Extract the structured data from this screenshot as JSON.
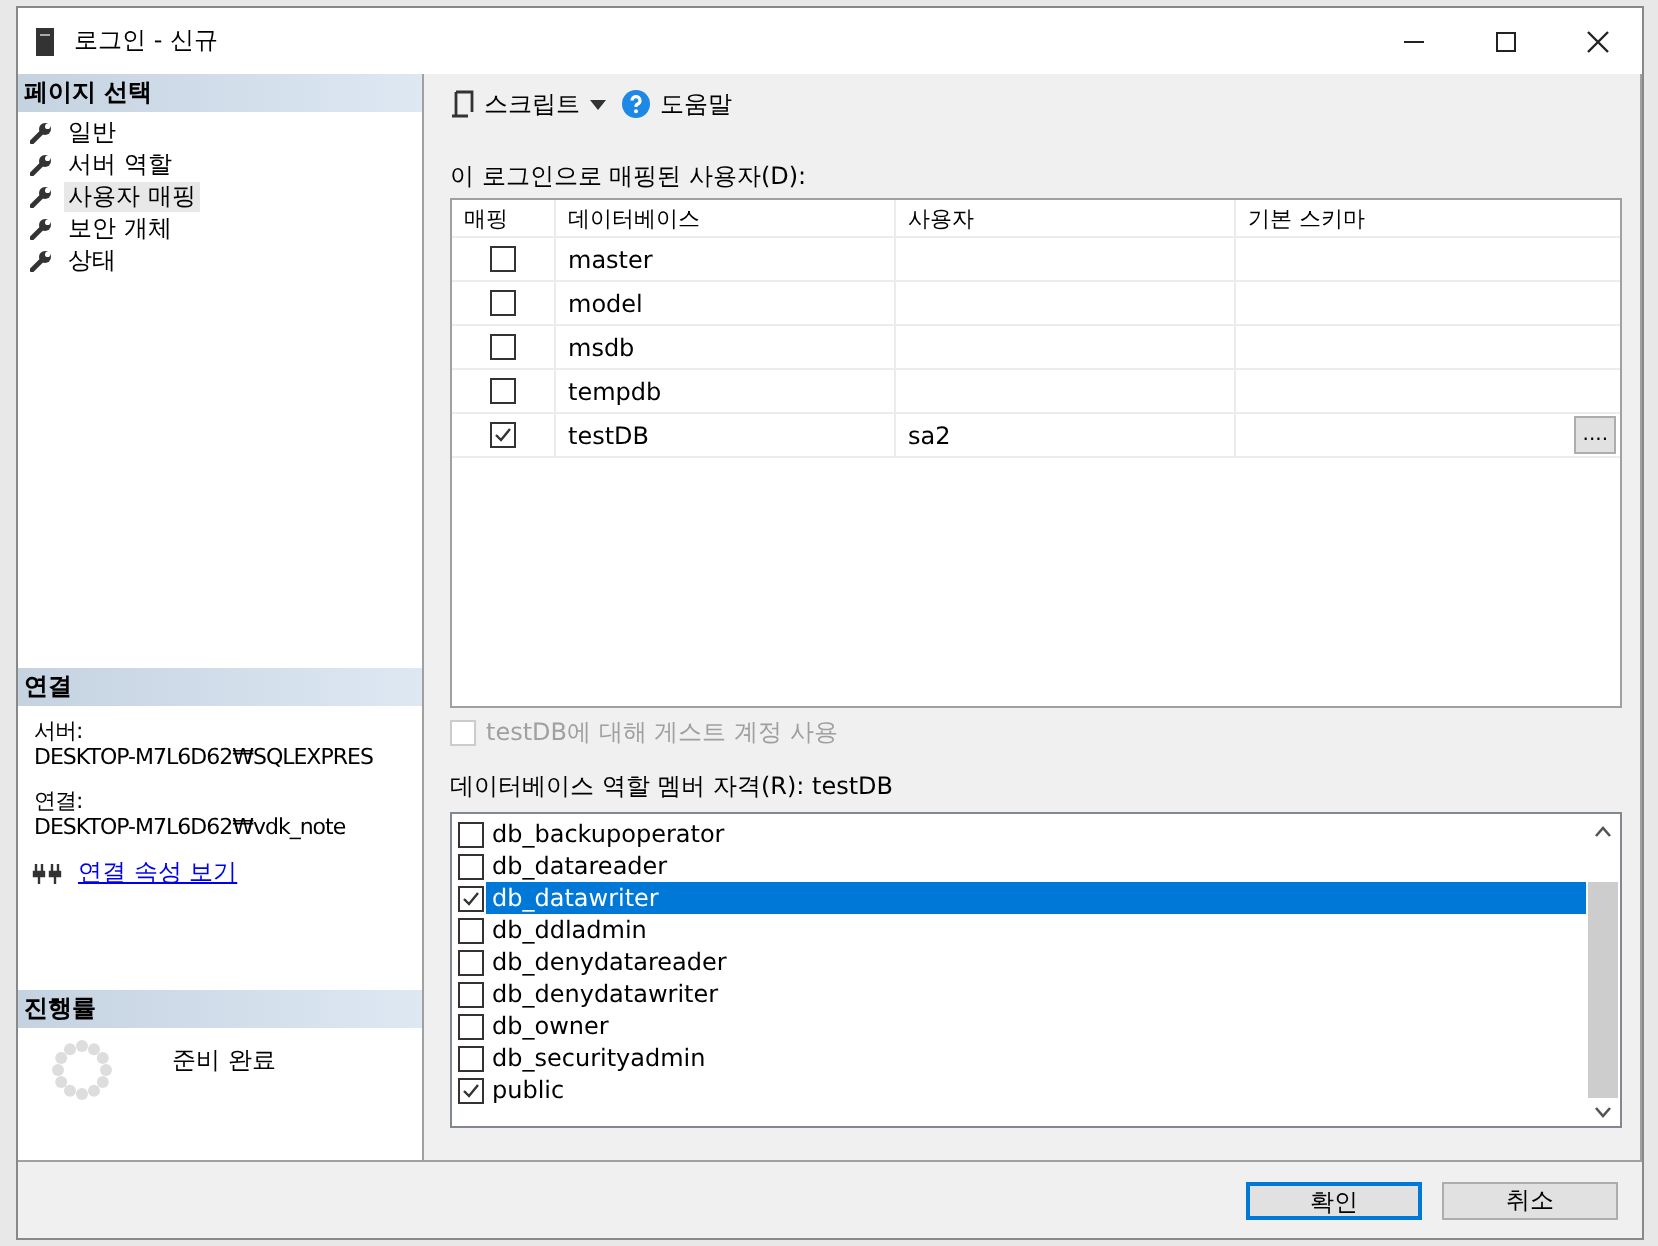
{
  "window": {
    "title": "로그인 - 신규"
  },
  "sidebar": {
    "header": "페이지 선택",
    "items": [
      {
        "label": "일반",
        "selected": false
      },
      {
        "label": "서버 역할",
        "selected": false
      },
      {
        "label": "사용자 매핑",
        "selected": true
      },
      {
        "label": "보안 개체",
        "selected": false
      },
      {
        "label": "상태",
        "selected": false
      }
    ]
  },
  "connection": {
    "header": "연결",
    "server_label": "서버:",
    "server": "DESKTOP-M7L6D62₩SQLEXPRES",
    "connection_label": "연결:",
    "connection": "DESKTOP-M7L6D62₩vdk_note",
    "link": "연결 속성 보기"
  },
  "progress": {
    "header": "진행률",
    "status": "준비 완료"
  },
  "toolbar": {
    "script": "스크립트",
    "help": "도움말"
  },
  "users_table": {
    "label": "이 로그인으로 매핑된 사용자(D):",
    "columns": [
      "매핑",
      "데이터베이스",
      "사용자",
      "기본 스키마"
    ],
    "rows": [
      {
        "checked": false,
        "database": "master"
      },
      {
        "checked": false,
        "database": "model"
      },
      {
        "checked": false,
        "database": "msdb"
      },
      {
        "checked": false,
        "database": "tempdb"
      },
      {
        "checked": true,
        "database": "testDB",
        "user": "sa2",
        "browse_button": "...."
      }
    ]
  },
  "guest_account": {
    "label": "testDB에 대해 게스트 계정 사용",
    "checked": false,
    "disabled": true
  },
  "roles": {
    "label": "데이터베이스 역할 멤버 자격(R): testDB",
    "items": [
      {
        "name": "db_backupoperator",
        "checked": false,
        "selected": false
      },
      {
        "name": "db_datareader",
        "checked": false,
        "selected": false
      },
      {
        "name": "db_datawriter",
        "checked": true,
        "selected": true
      },
      {
        "name": "db_ddladmin",
        "checked": false,
        "selected": false
      },
      {
        "name": "db_denydatareader",
        "checked": false,
        "selected": false
      },
      {
        "name": "db_denydatawriter",
        "checked": false,
        "selected": false
      },
      {
        "name": "db_owner",
        "checked": false,
        "selected": false
      },
      {
        "name": "db_securityadmin",
        "checked": false,
        "selected": false
      },
      {
        "name": "public",
        "checked": true,
        "selected": false
      }
    ]
  },
  "buttons": [
    {
      "label": "확인",
      "default": true
    },
    {
      "label": "취소",
      "default": false
    }
  ]
}
